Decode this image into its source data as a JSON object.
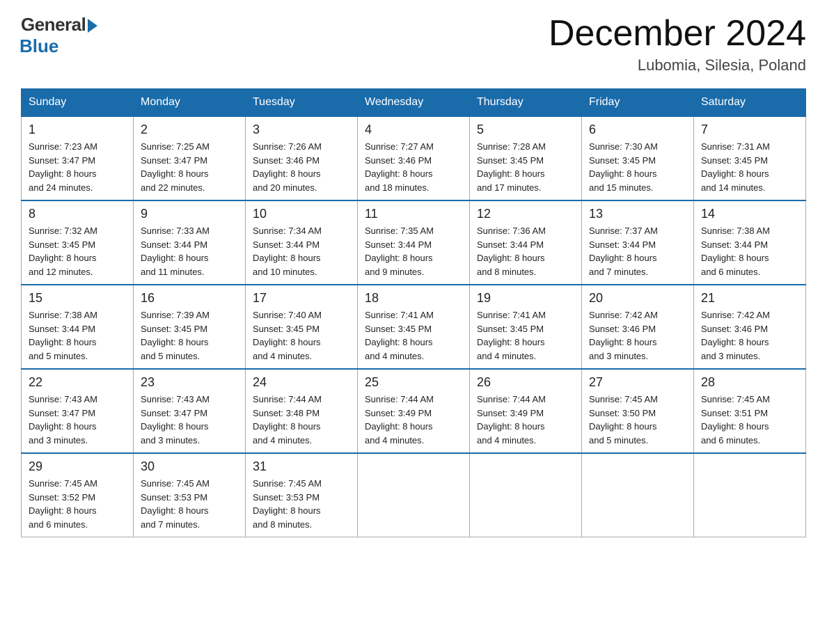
{
  "header": {
    "logo_general": "General",
    "logo_blue": "Blue",
    "month_title": "December 2024",
    "location": "Lubomia, Silesia, Poland"
  },
  "days_of_week": [
    "Sunday",
    "Monday",
    "Tuesday",
    "Wednesday",
    "Thursday",
    "Friday",
    "Saturday"
  ],
  "weeks": [
    [
      {
        "day": "1",
        "sunrise": "7:23 AM",
        "sunset": "3:47 PM",
        "daylight": "8 hours and 24 minutes."
      },
      {
        "day": "2",
        "sunrise": "7:25 AM",
        "sunset": "3:47 PM",
        "daylight": "8 hours and 22 minutes."
      },
      {
        "day": "3",
        "sunrise": "7:26 AM",
        "sunset": "3:46 PM",
        "daylight": "8 hours and 20 minutes."
      },
      {
        "day": "4",
        "sunrise": "7:27 AM",
        "sunset": "3:46 PM",
        "daylight": "8 hours and 18 minutes."
      },
      {
        "day": "5",
        "sunrise": "7:28 AM",
        "sunset": "3:45 PM",
        "daylight": "8 hours and 17 minutes."
      },
      {
        "day": "6",
        "sunrise": "7:30 AM",
        "sunset": "3:45 PM",
        "daylight": "8 hours and 15 minutes."
      },
      {
        "day": "7",
        "sunrise": "7:31 AM",
        "sunset": "3:45 PM",
        "daylight": "8 hours and 14 minutes."
      }
    ],
    [
      {
        "day": "8",
        "sunrise": "7:32 AM",
        "sunset": "3:45 PM",
        "daylight": "8 hours and 12 minutes."
      },
      {
        "day": "9",
        "sunrise": "7:33 AM",
        "sunset": "3:44 PM",
        "daylight": "8 hours and 11 minutes."
      },
      {
        "day": "10",
        "sunrise": "7:34 AM",
        "sunset": "3:44 PM",
        "daylight": "8 hours and 10 minutes."
      },
      {
        "day": "11",
        "sunrise": "7:35 AM",
        "sunset": "3:44 PM",
        "daylight": "8 hours and 9 minutes."
      },
      {
        "day": "12",
        "sunrise": "7:36 AM",
        "sunset": "3:44 PM",
        "daylight": "8 hours and 8 minutes."
      },
      {
        "day": "13",
        "sunrise": "7:37 AM",
        "sunset": "3:44 PM",
        "daylight": "8 hours and 7 minutes."
      },
      {
        "day": "14",
        "sunrise": "7:38 AM",
        "sunset": "3:44 PM",
        "daylight": "8 hours and 6 minutes."
      }
    ],
    [
      {
        "day": "15",
        "sunrise": "7:38 AM",
        "sunset": "3:44 PM",
        "daylight": "8 hours and 5 minutes."
      },
      {
        "day": "16",
        "sunrise": "7:39 AM",
        "sunset": "3:45 PM",
        "daylight": "8 hours and 5 minutes."
      },
      {
        "day": "17",
        "sunrise": "7:40 AM",
        "sunset": "3:45 PM",
        "daylight": "8 hours and 4 minutes."
      },
      {
        "day": "18",
        "sunrise": "7:41 AM",
        "sunset": "3:45 PM",
        "daylight": "8 hours and 4 minutes."
      },
      {
        "day": "19",
        "sunrise": "7:41 AM",
        "sunset": "3:45 PM",
        "daylight": "8 hours and 4 minutes."
      },
      {
        "day": "20",
        "sunrise": "7:42 AM",
        "sunset": "3:46 PM",
        "daylight": "8 hours and 3 minutes."
      },
      {
        "day": "21",
        "sunrise": "7:42 AM",
        "sunset": "3:46 PM",
        "daylight": "8 hours and 3 minutes."
      }
    ],
    [
      {
        "day": "22",
        "sunrise": "7:43 AM",
        "sunset": "3:47 PM",
        "daylight": "8 hours and 3 minutes."
      },
      {
        "day": "23",
        "sunrise": "7:43 AM",
        "sunset": "3:47 PM",
        "daylight": "8 hours and 3 minutes."
      },
      {
        "day": "24",
        "sunrise": "7:44 AM",
        "sunset": "3:48 PM",
        "daylight": "8 hours and 4 minutes."
      },
      {
        "day": "25",
        "sunrise": "7:44 AM",
        "sunset": "3:49 PM",
        "daylight": "8 hours and 4 minutes."
      },
      {
        "day": "26",
        "sunrise": "7:44 AM",
        "sunset": "3:49 PM",
        "daylight": "8 hours and 4 minutes."
      },
      {
        "day": "27",
        "sunrise": "7:45 AM",
        "sunset": "3:50 PM",
        "daylight": "8 hours and 5 minutes."
      },
      {
        "day": "28",
        "sunrise": "7:45 AM",
        "sunset": "3:51 PM",
        "daylight": "8 hours and 6 minutes."
      }
    ],
    [
      {
        "day": "29",
        "sunrise": "7:45 AM",
        "sunset": "3:52 PM",
        "daylight": "8 hours and 6 minutes."
      },
      {
        "day": "30",
        "sunrise": "7:45 AM",
        "sunset": "3:53 PM",
        "daylight": "8 hours and 7 minutes."
      },
      {
        "day": "31",
        "sunrise": "7:45 AM",
        "sunset": "3:53 PM",
        "daylight": "8 hours and 8 minutes."
      },
      null,
      null,
      null,
      null
    ]
  ],
  "labels": {
    "sunrise": "Sunrise:",
    "sunset": "Sunset:",
    "daylight": "Daylight:"
  }
}
